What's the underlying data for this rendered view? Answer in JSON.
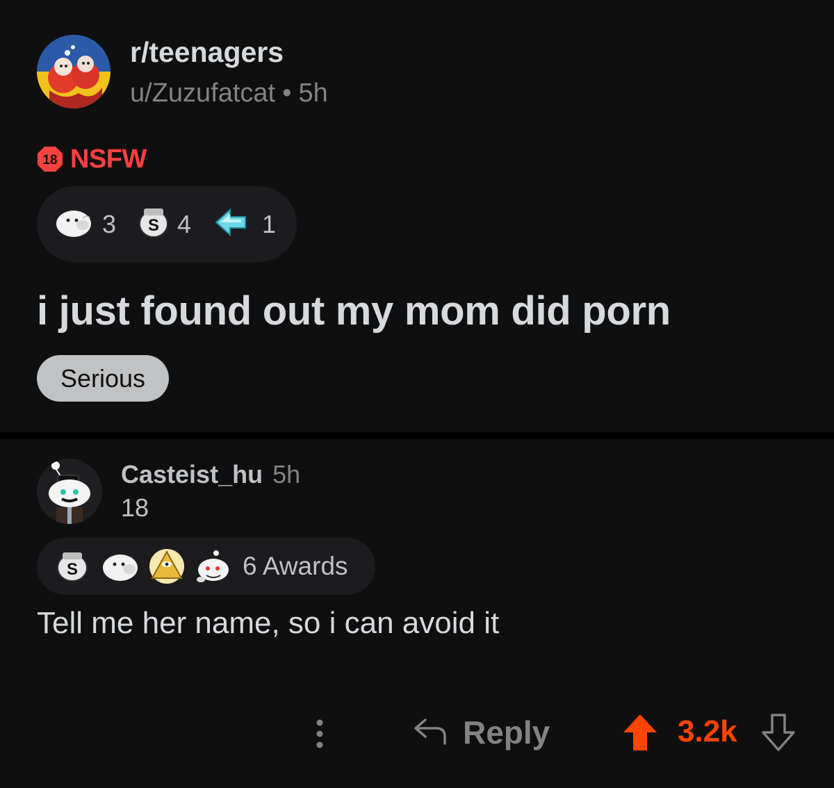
{
  "post": {
    "subreddit": "r/teenagers",
    "author": "u/Zuzufatcat",
    "separator": "•",
    "time": "5h",
    "nsfw_badge": "18",
    "nsfw_label": "NSFW",
    "awards": [
      {
        "icon": "seal-award-icon",
        "count": "3"
      },
      {
        "icon": "silver-award-icon",
        "count": "4"
      },
      {
        "icon": "arrow-award-icon",
        "count": "1"
      }
    ],
    "title": "i just found out my mom did porn",
    "flair": "Serious"
  },
  "comment": {
    "username": "Casteist_hu",
    "time": "5h",
    "user_flair": "18",
    "awards_label": "6 Awards",
    "award_icons": [
      "silver-award-icon",
      "seal-award-icon",
      "pyramid-award-icon",
      "snoo-award-icon"
    ],
    "body": "Tell me her name, so i can avoid it",
    "reply_label": "Reply",
    "score": "3.2k"
  },
  "colors": {
    "background": "#0f0f10",
    "nsfw": "#ff4040",
    "upvote": "#ff4500",
    "muted": "#818384",
    "flair_bg": "#c0c2c4"
  }
}
